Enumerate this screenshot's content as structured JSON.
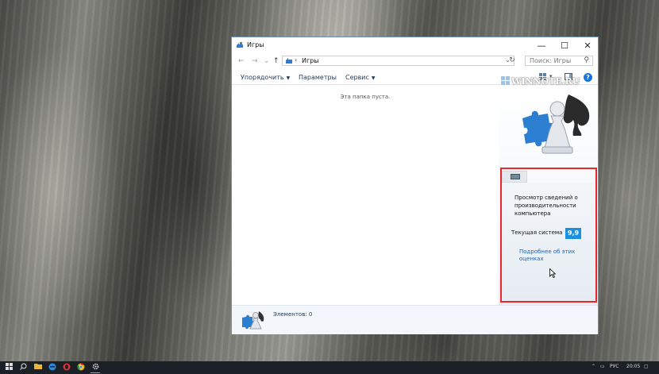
{
  "window": {
    "title": "Игры",
    "minimize": "—",
    "maximize": "☐",
    "close": "✕"
  },
  "address_bar": {
    "back": "←",
    "forward": "→",
    "recent_dropdown": "⌄",
    "up": "↑",
    "separator": "›",
    "path": "Игры",
    "dropdown": "⌄",
    "refresh": "↻",
    "search_placeholder": "Поиск: Игры",
    "search_icon": "⚲"
  },
  "toolbar": {
    "organize": "Упорядочить",
    "parameters": "Параметры",
    "service": "Сервис",
    "caret": "▼",
    "view_dropdown": "▾",
    "help": "?"
  },
  "content": {
    "empty_text": "Эта папка пуста."
  },
  "watermark": "WINNOTE.RU",
  "performance": {
    "heading": "Просмотр сведений о производительности компьютера",
    "current_label": "Текущая система",
    "score": "9,9",
    "more_link": "Подробнее об этих оценках"
  },
  "status": {
    "count": "Элементов: 0"
  },
  "taskbar": {
    "lang": "РУС",
    "time": "20:05"
  },
  "colors": {
    "highlight": "#e8262b",
    "score_bg": "#1d8fe0",
    "link": "#1c62b9",
    "taskbar": "#1b1f26"
  }
}
